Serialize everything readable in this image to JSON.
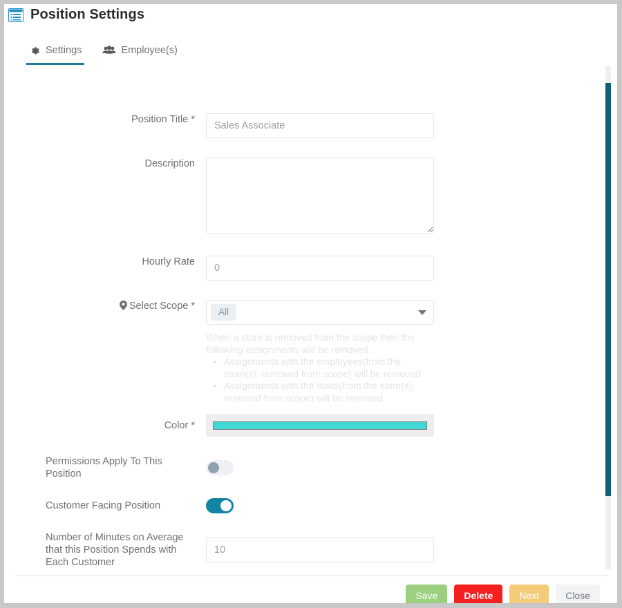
{
  "window": {
    "title": "Position Settings",
    "icon": "window-list-icon"
  },
  "tabs": [
    {
      "label": "Settings",
      "icon": "gear-icon",
      "active": true
    },
    {
      "label": "Employee(s)",
      "icon": "users-icon",
      "active": false
    }
  ],
  "form": {
    "position_title": {
      "label": "Position Title *",
      "placeholder": "Sales Associate",
      "value": ""
    },
    "description": {
      "label": "Description",
      "placeholder": "",
      "value": ""
    },
    "hourly_rate": {
      "label": "Hourly Rate",
      "placeholder": "0",
      "value": ""
    },
    "select_scope": {
      "label": "Select Scope *",
      "icon": "map-pin-icon",
      "selected_chip": "All",
      "caret": "chevron-down-icon"
    },
    "scope_help": {
      "intro": "When a store is removed from the scope then the following assignments will be removed.",
      "bullets": [
        "Assignments with the employees(from the store(s), removed from scope) will be removed",
        "Assignments with the tasks(from the store(s), removed from scope) will be removed"
      ]
    },
    "color": {
      "label": "Color *",
      "value": "#3fd8d4"
    },
    "permissions_toggle": {
      "label": "Permissions Apply To This Position",
      "state": "off"
    },
    "customer_facing_toggle": {
      "label": "Customer Facing Position",
      "state": "on"
    },
    "minutes_per_customer": {
      "label": "Number of Minutes on Average that this Position Spends with Each Customer",
      "placeholder": "10",
      "value": ""
    }
  },
  "footer": {
    "save": "Save",
    "delete": "Delete",
    "next": "Next",
    "close": "Close"
  },
  "colors": {
    "accent_teal": "#1b7e96",
    "toggle_on": "#1185a3",
    "scrollbar_thumb": "#0e5f76",
    "save": "#9cd07f",
    "delete": "#f41f1f",
    "next": "#f3cc7a",
    "close": "#f2f3f5"
  }
}
